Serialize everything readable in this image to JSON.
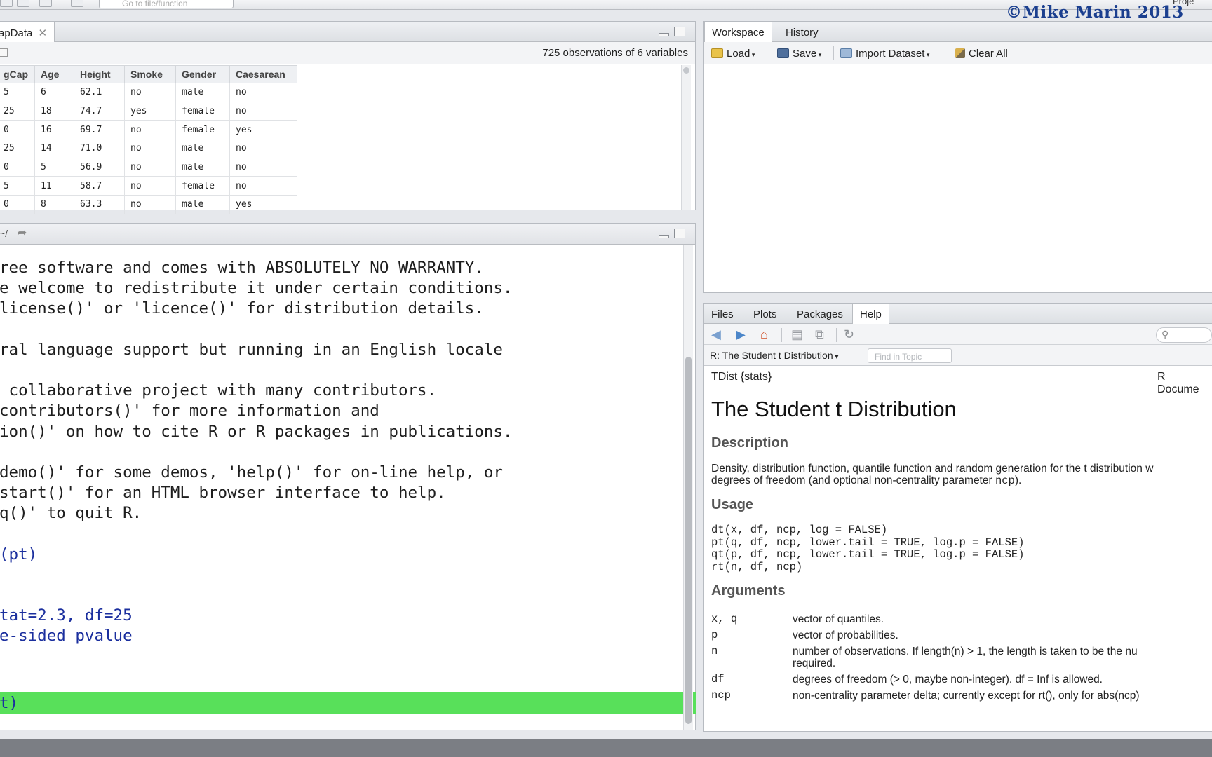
{
  "toolbar": {
    "goto_placeholder": "Go to file/function",
    "copyright": "©Mike Marin 2013",
    "project": "Proje"
  },
  "data_viewer": {
    "tab_label": "apData",
    "obs_text": "725 observations of 6 variables",
    "columns": [
      "gCap",
      "Age",
      "Height",
      "Smoke",
      "Gender",
      "Caesarean"
    ],
    "rows": [
      [
        "5",
        "6",
        "62.1",
        "no",
        "male",
        "no"
      ],
      [
        "25",
        "18",
        "74.7",
        "yes",
        "female",
        "no"
      ],
      [
        "0",
        "16",
        "69.7",
        "no",
        "female",
        "yes"
      ],
      [
        "25",
        "14",
        "71.0",
        "no",
        "male",
        "no"
      ],
      [
        "0",
        "5",
        "56.9",
        "no",
        "male",
        "no"
      ],
      [
        "5",
        "11",
        "58.7",
        "no",
        "female",
        "no"
      ],
      [
        "0",
        "8",
        "63.3",
        "no",
        "male",
        "yes"
      ]
    ]
  },
  "console": {
    "path": "~/",
    "lines": [
      {
        "text": "ree software and comes with ABSOLUTELY NO WARRANTY.",
        "cls": ""
      },
      {
        "text": "e welcome to redistribute it under certain conditions.",
        "cls": ""
      },
      {
        "text": "license()' or 'licence()' for distribution details.",
        "cls": ""
      },
      {
        "text": "",
        "cls": ""
      },
      {
        "text": "ral language support but running in an English locale",
        "cls": ""
      },
      {
        "text": "",
        "cls": ""
      },
      {
        "text": " collaborative project with many contributors.",
        "cls": ""
      },
      {
        "text": "contributors()' for more information and",
        "cls": ""
      },
      {
        "text": "ion()' on how to cite R or R packages in publications.",
        "cls": ""
      },
      {
        "text": "",
        "cls": ""
      },
      {
        "text": "demo()' for some demos, 'help()' for on-line help, or",
        "cls": ""
      },
      {
        "text": "start()' for an HTML browser interface to help.",
        "cls": ""
      },
      {
        "text": "q()' to quit R.",
        "cls": ""
      },
      {
        "text": "",
        "cls": ""
      },
      {
        "text": "(pt)",
        "cls": "blue"
      },
      {
        "text": "",
        "cls": ""
      },
      {
        "text": "",
        "cls": ""
      },
      {
        "text": "tat=2.3, df=25",
        "cls": "blue"
      },
      {
        "text": "e-sided pvalue",
        "cls": "blue"
      }
    ],
    "current_input": "t)"
  },
  "workspace": {
    "tabs": [
      "Workspace",
      "History"
    ],
    "buttons": {
      "load": "Load",
      "save": "Save",
      "import": "Import Dataset",
      "clear": "Clear All"
    }
  },
  "files_panel": {
    "tabs": [
      "Files",
      "Plots",
      "Packages",
      "Help"
    ],
    "topic": "R: The Student t Distribution",
    "find_placeholder": "Find in Topic"
  },
  "help": {
    "meta_left": "TDist {stats}",
    "meta_right": "R Docume",
    "title": "The Student t Distribution",
    "sec_description": "Description",
    "description_1": "Density, distribution function, quantile function and random generation for the t distribution w",
    "description_2a": "degrees of freedom (and optional non-centrality parameter ",
    "description_2b": "ncp",
    "description_2c": ").",
    "sec_usage": "Usage",
    "usage": "dt(x, df, ncp, log = FALSE)\npt(q, df, ncp, lower.tail = TRUE, log.p = FALSE)\nqt(p, df, ncp, lower.tail = TRUE, log.p = FALSE)\nrt(n, df, ncp)",
    "sec_arguments": "Arguments",
    "args": [
      {
        "name": "x, q",
        "desc": "vector of quantiles."
      },
      {
        "name": "p",
        "desc": "vector of probabilities."
      },
      {
        "name": "n",
        "desc": "number of observations. If length(n) > 1, the length is taken to be the nu",
        "desc2": "required."
      },
      {
        "name": "df",
        "desc": "degrees of freedom (> 0, maybe non-integer). df = Inf is allowed."
      },
      {
        "name": "ncp",
        "desc": "non-centrality parameter delta; currently except for rt(), only for abs(ncp)"
      }
    ]
  }
}
